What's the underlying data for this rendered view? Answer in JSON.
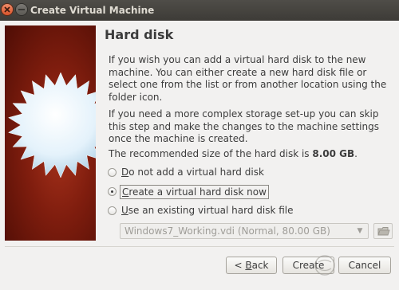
{
  "window": {
    "title": "Create Virtual Machine"
  },
  "page": {
    "heading": "Hard disk",
    "paragraph1": "If you wish you can add a virtual hard disk to the new machine. You can either create a new hard disk file or select one from the list or from another location using the folder icon.",
    "paragraph2": "If you need a more complex storage set-up you can skip this step and make the changes to the machine settings once the machine is created.",
    "recommended_prefix": "The recommended size of the hard disk is ",
    "recommended_size": "8.00 GB",
    "recommended_suffix": "."
  },
  "options": [
    {
      "mnemonic": "D",
      "rest": "o not add a virtual hard disk",
      "selected": false
    },
    {
      "mnemonic": "C",
      "rest": "reate a virtual hard disk now",
      "selected": true
    },
    {
      "mnemonic": "U",
      "rest": "se an existing virtual hard disk file",
      "selected": false
    }
  ],
  "existing_disk": {
    "value": "Windows7_Working.vdi (Normal, 80.00 GB)"
  },
  "buttons": {
    "back_prefix": "< ",
    "back_mnemonic": "B",
    "back_rest": "ack",
    "create": "Create",
    "cancel": "Cancel"
  },
  "icons": {
    "close": "close-icon",
    "minimize": "minimize-icon",
    "dropdown": "chevron-down-icon",
    "folder": "folder-icon",
    "wizard_art": "starburst-icon"
  },
  "colors": {
    "titlebar": "#3d3b37",
    "close": "#d9542b",
    "art_red": "#7f1d0e"
  }
}
